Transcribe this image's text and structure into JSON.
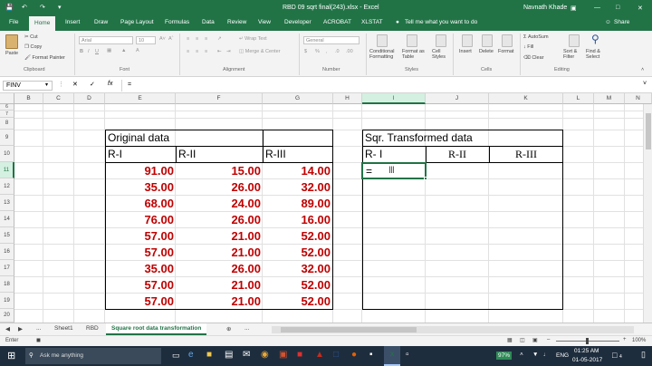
{
  "window": {
    "title": "RBD 09 sqrt final(243).xlsx - Excel",
    "user": "Navnath Khade"
  },
  "tabs": [
    "File",
    "Home",
    "Insert",
    "Draw",
    "Page Layout",
    "Formulas",
    "Data",
    "Review",
    "View",
    "Developer",
    "ACROBAT",
    "XLSTAT"
  ],
  "tell_me": "Tell me what you want to do",
  "share": "Share",
  "ribbon": {
    "cut": "Cut",
    "copy": "Copy",
    "format_painter": "Format Painter",
    "paste": "Paste",
    "clipboard": "Clipboard",
    "font_name": "Arial",
    "font_size": "10",
    "font": "Font",
    "wrap_text": "Wrap Text",
    "merge_center": "Merge & Center",
    "alignment": "Alignment",
    "number_format": "General",
    "number": "Number",
    "conditional_formatting": "Conditional Formatting",
    "format_as_table": "Format as Table",
    "cell_styles": "Cell Styles",
    "styles": "Styles",
    "insert": "Insert",
    "delete": "Delete",
    "format": "Format",
    "cells": "Cells",
    "autosum": "AutoSum",
    "fill": "Fill",
    "clear": "Clear",
    "sort_filter": "Sort & Filter",
    "find_select": "Find & Select",
    "editing": "Editing"
  },
  "formula_bar": {
    "name_box": "FINV",
    "fx": "fx",
    "content": "="
  },
  "columns": [
    "B",
    "C",
    "D",
    "E",
    "F",
    "G",
    "H",
    "I",
    "J",
    "K",
    "L",
    "M",
    "N"
  ],
  "rows": [
    "6",
    "7",
    "8",
    "9",
    "10",
    "11",
    "12",
    "13",
    "14",
    "15",
    "16",
    "17",
    "18",
    "19",
    "20"
  ],
  "original": {
    "title": "Original data",
    "headers": [
      "R-I",
      "R-II",
      "R-III"
    ],
    "data": [
      [
        "91.00",
        "15.00",
        "14.00"
      ],
      [
        "35.00",
        "26.00",
        "32.00"
      ],
      [
        "68.00",
        "24.00",
        "89.00"
      ],
      [
        "76.00",
        "26.00",
        "16.00"
      ],
      [
        "57.00",
        "21.00",
        "52.00"
      ],
      [
        "57.00",
        "21.00",
        "52.00"
      ],
      [
        "35.00",
        "26.00",
        "32.00"
      ],
      [
        "57.00",
        "21.00",
        "52.00"
      ],
      [
        "57.00",
        "21.00",
        "52.00"
      ]
    ]
  },
  "transformed": {
    "title": "Sqr. Transformed data",
    "headers": [
      "R- I",
      "R-II",
      "R-III"
    ],
    "active_entry": "="
  },
  "sheets": [
    "Sheet1",
    "RBD",
    "Square root data transformation"
  ],
  "status": {
    "mode": "Enter",
    "zoom": "100%"
  },
  "taskbar": {
    "search": "Ask me anything",
    "time": "01:25 AM",
    "date": "01-05-2017",
    "lang": "ENG",
    "battery": "97%"
  },
  "colors": {
    "excel_green": "#217346",
    "data_red": "#c00000"
  }
}
